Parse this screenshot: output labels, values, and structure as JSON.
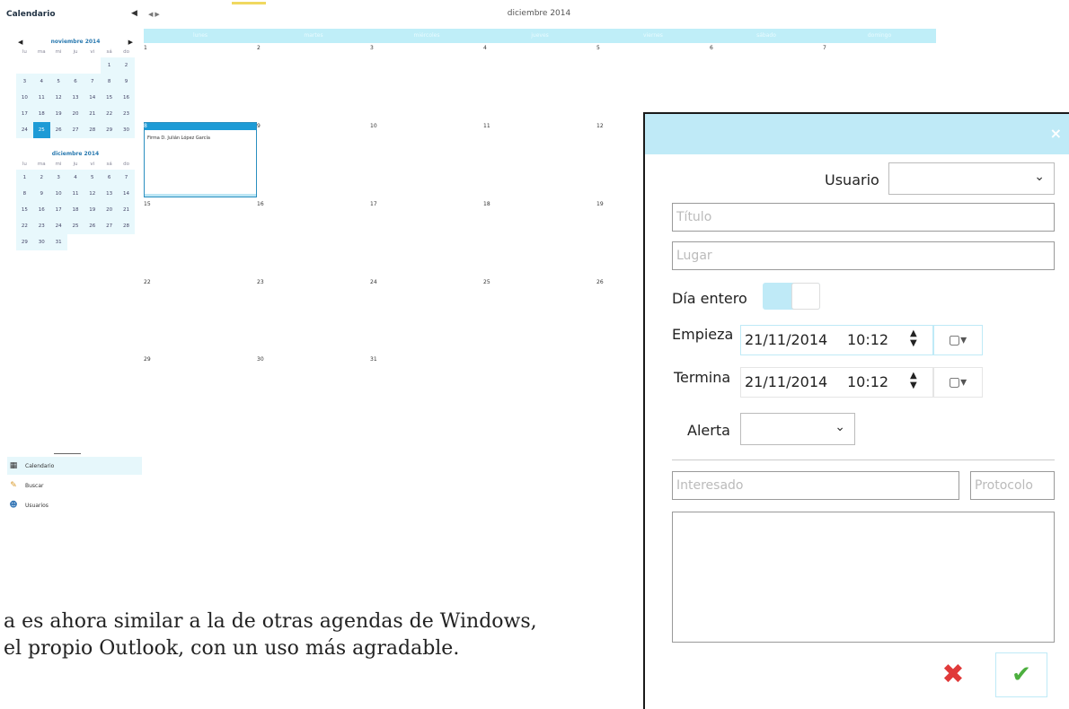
{
  "sidebar": {
    "title": "Calendario",
    "mini_calendar_1": {
      "month": "noviembre 2014",
      "weekdays": [
        "lu",
        "ma",
        "mi",
        "ju",
        "vi",
        "sá",
        "do"
      ],
      "rows": [
        [
          "",
          "",
          "",
          "",
          "",
          "1",
          "2"
        ],
        [
          "3",
          "4",
          "5",
          "6",
          "7",
          "8",
          "9"
        ],
        [
          "10",
          "11",
          "12",
          "13",
          "14",
          "15",
          "16"
        ],
        [
          "17",
          "18",
          "19",
          "20",
          "21",
          "22",
          "23"
        ],
        [
          "24",
          "25",
          "26",
          "27",
          "28",
          "29",
          "30"
        ]
      ],
      "selected": "25"
    },
    "mini_calendar_2": {
      "month": "diciembre 2014",
      "weekdays": [
        "lu",
        "ma",
        "mi",
        "ju",
        "vi",
        "sá",
        "do"
      ],
      "rows": [
        [
          "1",
          "2",
          "3",
          "4",
          "5",
          "6",
          "7"
        ],
        [
          "8",
          "9",
          "10",
          "11",
          "12",
          "13",
          "14"
        ],
        [
          "15",
          "16",
          "17",
          "18",
          "19",
          "20",
          "21"
        ],
        [
          "22",
          "23",
          "24",
          "25",
          "26",
          "27",
          "28"
        ],
        [
          "29",
          "30",
          "31",
          "",
          "",
          "",
          ""
        ]
      ]
    },
    "nav": [
      {
        "label": "Calendario",
        "icon": "calendar-icon"
      },
      {
        "label": "Buscar",
        "icon": "pencil-icon"
      },
      {
        "label": "Usuarios",
        "icon": "users-icon"
      }
    ]
  },
  "calendar": {
    "month_title": "diciembre 2014",
    "weekday_headers": [
      "lunes",
      "martes",
      "miércoles",
      "jueves",
      "viernes",
      "sábado",
      "domingo"
    ],
    "weeks": [
      [
        "1",
        "2",
        "3",
        "4",
        "5",
        "6",
        "7"
      ],
      [
        "8",
        "9",
        "10",
        "11",
        "12",
        "",
        ""
      ],
      [
        "15",
        "16",
        "17",
        "18",
        "19",
        "",
        ""
      ],
      [
        "22",
        "23",
        "24",
        "25",
        "26",
        "",
        ""
      ],
      [
        "29",
        "30",
        "31",
        "",
        "",
        "",
        ""
      ]
    ],
    "event": {
      "day": "8",
      "text": "Firma D. Julián López García"
    }
  },
  "caption": {
    "line1": "a es ahora similar a la de otras agendas de Windows,",
    "line2": "el propio Outlook, con un uso más agradable."
  },
  "dialog": {
    "close_glyph": "×",
    "usuario_label": "Usuario",
    "usuario_value": "",
    "titulo_placeholder": "Título",
    "lugar_placeholder": "Lugar",
    "dia_entero_label": "Día entero",
    "empieza_label": "Empieza",
    "empieza_date": "21/11/2014",
    "empieza_time": "10:12",
    "termina_label": "Termina",
    "termina_date": "21/11/2014",
    "termina_time": "10:12",
    "alerta_label": "Alerta",
    "alerta_value": "",
    "interesado_placeholder": "Interesado",
    "protocolo_placeholder": "Protocolo",
    "notes_value": ""
  },
  "colors": {
    "accent": "#bfeaf7",
    "selected": "#1d9bd6",
    "cancel": "#e03a3a",
    "confirm": "#4caf3e"
  }
}
